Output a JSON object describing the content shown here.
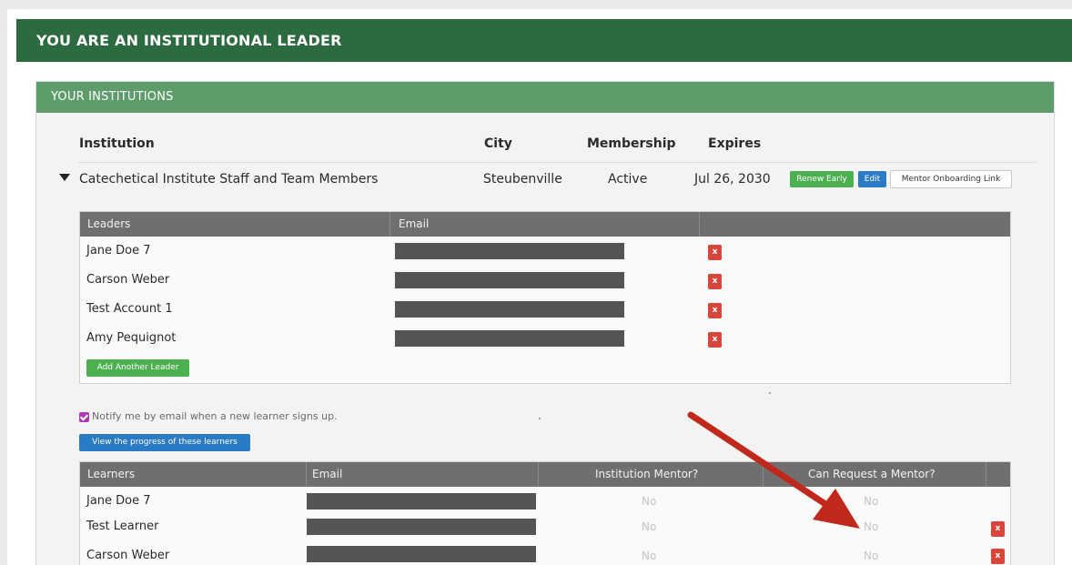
{
  "banner": {
    "title": "YOU ARE AN INSTITUTIONAL LEADER"
  },
  "institutions_panel": {
    "title": "YOUR INSTITUTIONS",
    "columns": [
      "Institution",
      "City",
      "Membership",
      "Expires"
    ],
    "institution": {
      "name": "Catechetical Institute Staff and Team Members",
      "city": "Steubenville",
      "membership": "Active",
      "expires": "Jul 26, 2030",
      "actions": {
        "renew": "Renew Early",
        "edit": "Edit",
        "mentor_link": "Mentor Onboarding Link"
      }
    }
  },
  "leaders_table": {
    "headers": [
      "Leaders",
      "Email"
    ],
    "rows": [
      {
        "name": "Jane Doe 7",
        "remove": "x"
      },
      {
        "name": "Carson Weber",
        "remove": "x"
      },
      {
        "name": "Test Account 1",
        "remove": "x"
      },
      {
        "name": "Amy Pequignot",
        "remove": "x"
      }
    ],
    "add_button": "Add Another Leader"
  },
  "notify": {
    "label": "Notify me by email when a new learner signs up.",
    "checked": true
  },
  "progress_button": "View the progress of these learners",
  "learners_table": {
    "headers": [
      "Learners",
      "Email",
      "Institution Mentor?",
      "Can Request a Mentor?"
    ],
    "rows": [
      {
        "name": "Jane Doe 7",
        "institution_mentor": "No",
        "can_request": "No"
      },
      {
        "name": "Test Learner",
        "institution_mentor": "No",
        "can_request": "No",
        "remove": "x"
      },
      {
        "name": "Carson Weber",
        "institution_mentor": "No",
        "can_request": "No",
        "remove": "x"
      }
    ]
  },
  "colors": {
    "banner": "#2c6a3f",
    "panel_header": "#5e9d6b",
    "table_header": "#6f6f6f",
    "primary_green": "#4caf50",
    "primary_blue": "#2a7ac4",
    "danger_red": "#d9453b",
    "annotation_arrow": "#c0281c"
  }
}
